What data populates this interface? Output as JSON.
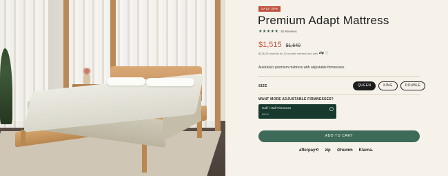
{
  "product": {
    "badge": "SALE 30%",
    "title": "Premium Adapt Mattress",
    "stars": "★★★★★",
    "reviews": "80 Reviews",
    "price": "$1,515",
    "old_price": "$1,640",
    "financing_text": "$126.25 monthly for 12 months interest-free with",
    "financing_provider": "zip",
    "financing_info": "ⓘ",
    "description": "Australia's premium mattress with adjustable firmnesses."
  },
  "size": {
    "label": "SIZE",
    "options": [
      "QUEEN",
      "KING",
      "DOUBLE"
    ],
    "selected": "QUEEN"
  },
  "firmness": {
    "label": "WANT MORE ADJUSTABLE FIRMNESSES?",
    "option_name": "Half / Half Firmness",
    "option_price": "$50.0"
  },
  "cart": {
    "label": "ADD TO CART"
  },
  "payments": [
    "afterpay⟲",
    "zip",
    "⊙humm",
    "Klarna."
  ],
  "colors": {
    "accent": "#c0533f",
    "primary": "#3d6a59",
    "dark_green": "#183a2e",
    "background": "#f6f2ea"
  }
}
